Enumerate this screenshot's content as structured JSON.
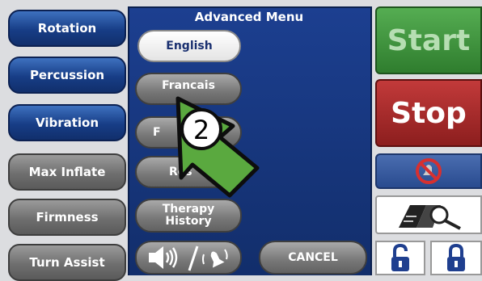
{
  "left_menu": {
    "rotation": "Rotation",
    "percussion": "Percussion",
    "vibration": "Vibration",
    "max_inflate": "Max Inflate",
    "firmness": "Firmness",
    "turn_assist": "Turn Assist"
  },
  "panel": {
    "title": "Advanced Menu",
    "english": "English",
    "francais": "Francais",
    "hidden_btn_partial": "F",
    "reset_partial": "Res",
    "therapy_history": "Therapy History",
    "cancel": "CANCEL",
    "sound_alarm_icons": [
      "speaker-icon",
      "bell-icon"
    ]
  },
  "right_menu": {
    "start": "Start",
    "stop": "Stop",
    "mute_icon": "no-alarm-icon",
    "manual_icon": "book-magnifier-icon",
    "unlock_icon": "unlocked-padlock-icon",
    "lock_icon": "locked-padlock-icon"
  },
  "overlay": {
    "step_number": "2",
    "arrow_color": "#5aa93f",
    "accent_blue": "#173d86",
    "start_green": "#3c943a",
    "stop_red": "#a62a2a"
  }
}
